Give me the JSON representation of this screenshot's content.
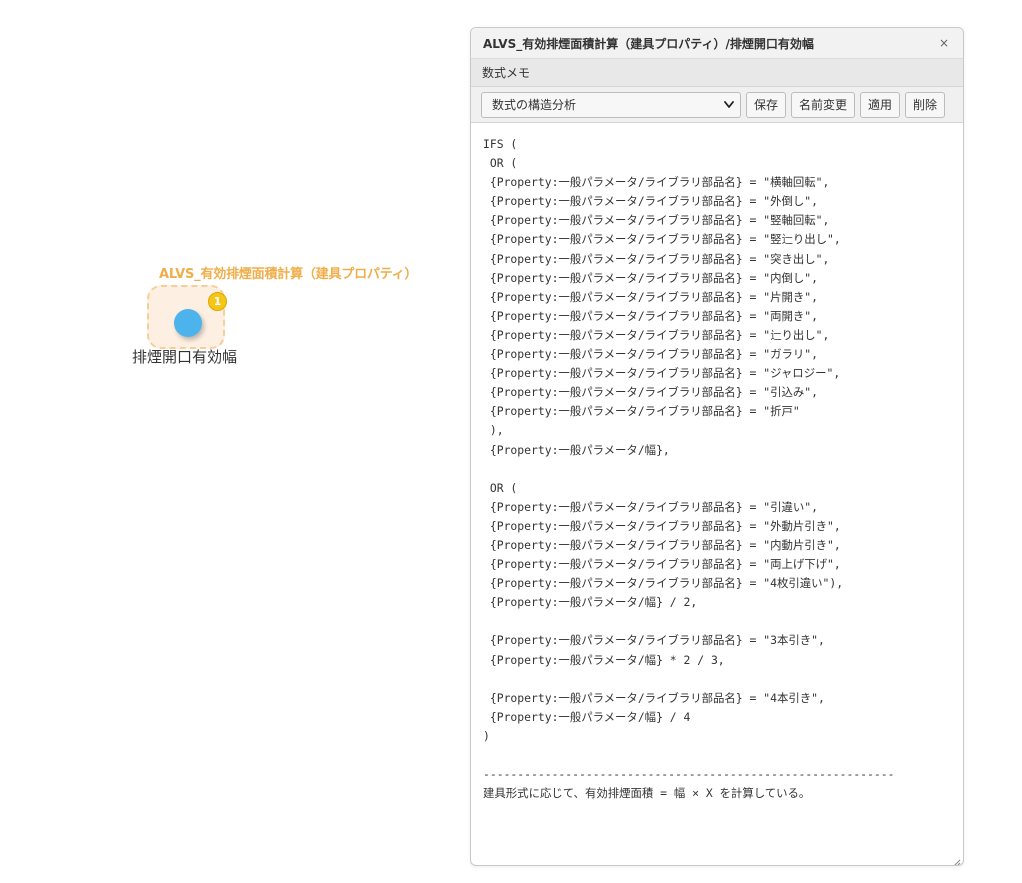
{
  "canvas": {
    "node": {
      "group_label": "ALVS_有効排煙面積計算（建具プロパティ）",
      "badge_count": "1",
      "label": "排煙開口有効幅",
      "dot_color": "#4cb3ec",
      "box_color": "#fdf0e2",
      "group_label_color": "#f0ae4a",
      "badge_color": "#f5c518"
    }
  },
  "panel": {
    "title": "ALVS_有効排煙面積計算（建具プロパティ）/排煙開口有効幅",
    "close_label": "×",
    "section_label": "数式メモ",
    "toolbar": {
      "selected_option": "数式の構造分析",
      "save_label": "保存",
      "rename_label": "名前変更",
      "apply_label": "適用",
      "delete_label": "削除"
    },
    "editor_text": "IFS (\n OR (\n {Property:一般パラメータ/ライブラリ部品名} = \"横軸回転\",\n {Property:一般パラメータ/ライブラリ部品名} = \"外倒し\",\n {Property:一般パラメータ/ライブラリ部品名} = \"竪軸回転\",\n {Property:一般パラメータ/ライブラリ部品名} = \"竪辷り出し\",\n {Property:一般パラメータ/ライブラリ部品名} = \"突き出し\",\n {Property:一般パラメータ/ライブラリ部品名} = \"内倒し\",\n {Property:一般パラメータ/ライブラリ部品名} = \"片開き\",\n {Property:一般パラメータ/ライブラリ部品名} = \"両開き\",\n {Property:一般パラメータ/ライブラリ部品名} = \"辷り出し\",\n {Property:一般パラメータ/ライブラリ部品名} = \"ガラリ\",\n {Property:一般パラメータ/ライブラリ部品名} = \"ジャロジー\",\n {Property:一般パラメータ/ライブラリ部品名} = \"引込み\",\n {Property:一般パラメータ/ライブラリ部品名} = \"折戸\"\n ),\n {Property:一般パラメータ/幅},\n\n OR (\n {Property:一般パラメータ/ライブラリ部品名} = \"引違い\",\n {Property:一般パラメータ/ライブラリ部品名} = \"外動片引き\",\n {Property:一般パラメータ/ライブラリ部品名} = \"内動片引き\",\n {Property:一般パラメータ/ライブラリ部品名} = \"両上げ下げ\",\n {Property:一般パラメータ/ライブラリ部品名} = \"4枚引違い\"),\n {Property:一般パラメータ/幅} / 2,\n\n {Property:一般パラメータ/ライブラリ部品名} = \"3本引き\",\n {Property:一般パラメータ/幅} * 2 / 3,\n\n {Property:一般パラメータ/ライブラリ部品名} = \"4本引き\",\n {Property:一般パラメータ/幅} / 4\n)\n\n------------------------------------------------------------\n建具形式に応じて、有効排煙面積 = 幅 × X を計算している。"
  }
}
